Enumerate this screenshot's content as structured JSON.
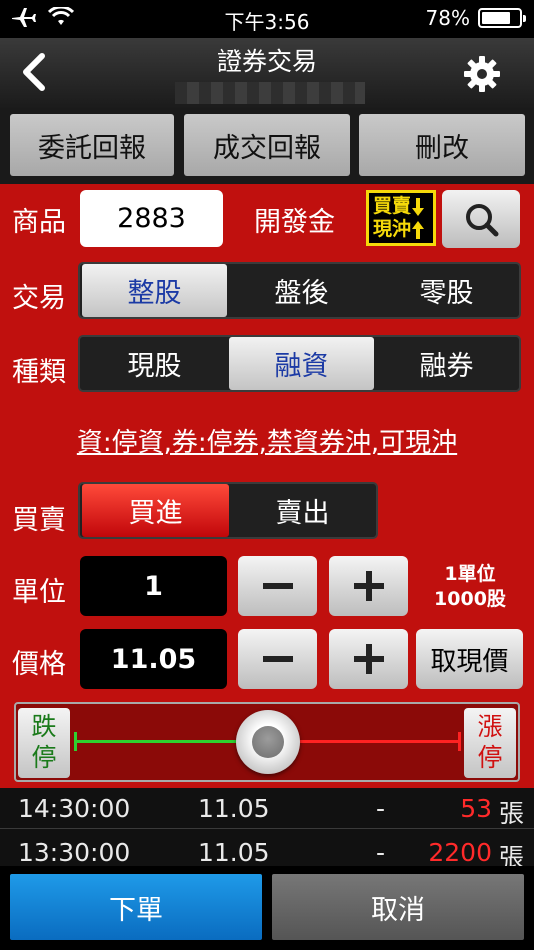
{
  "status_bar": {
    "time": "下午3:56",
    "battery": "78%",
    "battery_level": 0.78
  },
  "nav": {
    "title": "證券交易"
  },
  "tabs": [
    "委託回報",
    "成交回報",
    "刪改"
  ],
  "product": {
    "label": "商品",
    "code": "2883",
    "name": "開發金",
    "badge_line1": "買賣",
    "badge_line2": "現沖"
  },
  "trade_type": {
    "label": "交易",
    "options": [
      "整股",
      "盤後",
      "零股"
    ],
    "selected": "整股"
  },
  "category": {
    "label": "種類",
    "options": [
      "現股",
      "融資",
      "融券"
    ],
    "selected": "融資"
  },
  "notice": "資:停資,券:停券,禁資券沖,可現沖",
  "side": {
    "label": "買賣",
    "options": [
      "買進",
      "賣出"
    ],
    "selected": "買進"
  },
  "unit": {
    "label": "單位",
    "value": "1",
    "note_line1": "1單位",
    "note_line2": "1000股"
  },
  "price": {
    "label": "價格",
    "value": "11.05",
    "quote_button": "取現價"
  },
  "limits": {
    "down_line1": "跌",
    "down_line2": "停",
    "up_line1": "漲",
    "up_line2": "停"
  },
  "ticks": [
    {
      "time": "14:30:00",
      "price": "11.05",
      "change": "-",
      "volume": "53",
      "unit": "張"
    },
    {
      "time": "13:30:00",
      "price": "11.05",
      "change": "-",
      "volume": "2200",
      "unit": "張"
    }
  ],
  "actions": {
    "submit": "下單",
    "cancel": "取消"
  },
  "colors": {
    "main_bg": "#c0100e",
    "accent_blue": "#0a7fd6",
    "badge_yellow": "#f5d90a",
    "limit_up": "#ff2222",
    "limit_down": "#2fd12f"
  }
}
